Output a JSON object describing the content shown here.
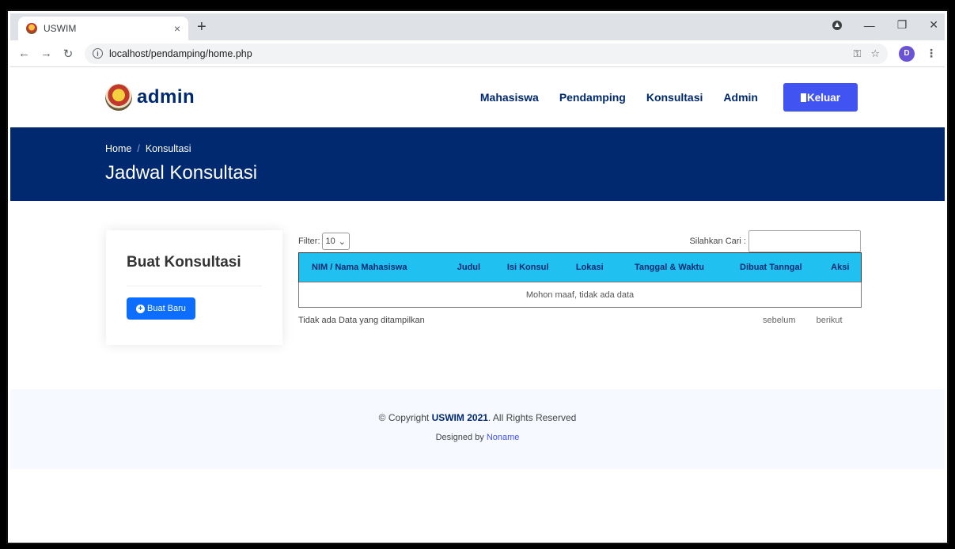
{
  "browser": {
    "tab_title": "USWIM",
    "tab_close": "×",
    "new_tab": "+",
    "url": "localhost/pendamping/home.php",
    "avatar_letter": "D"
  },
  "header": {
    "logo_text": "admin",
    "nav": [
      "Mahasiswa",
      "Pendamping",
      "Konsultasi",
      "Admin"
    ],
    "logout_label": "Keluar"
  },
  "band": {
    "crumbs": [
      "Home",
      "Konsultasi"
    ],
    "separator": "/",
    "title": "Jadwal Konsultasi"
  },
  "card": {
    "title": "Buat Konsultasi",
    "button_label": "Buat Baru"
  },
  "table": {
    "filter_label": "Filter:",
    "filter_value": "10",
    "search_label": "Silahkan Cari :",
    "columns": [
      "NIM / Nama Mahasiswa",
      "Judul",
      "Isi Konsul",
      "Lokasi",
      "Tanggal & Waktu",
      "Dibuat Tanngal",
      "Aksi"
    ],
    "empty_message": "Mohon maaf, tidak ada data",
    "info": "Tidak ada Data yang ditampilkan",
    "prev": "sebelum",
    "next": "berikut"
  },
  "footer": {
    "copyright_prefix": "© Copyright",
    "copyright_brand": "USWIM 2021",
    "copyright_suffix": ". All Rights Reserved",
    "designed_by": "Designed by",
    "designer": "Noname"
  },
  "colors": {
    "brand_navy": "#012970",
    "accent_blue": "#4154f1",
    "table_header": "#20c1f0",
    "button_blue": "#0d6efd"
  }
}
